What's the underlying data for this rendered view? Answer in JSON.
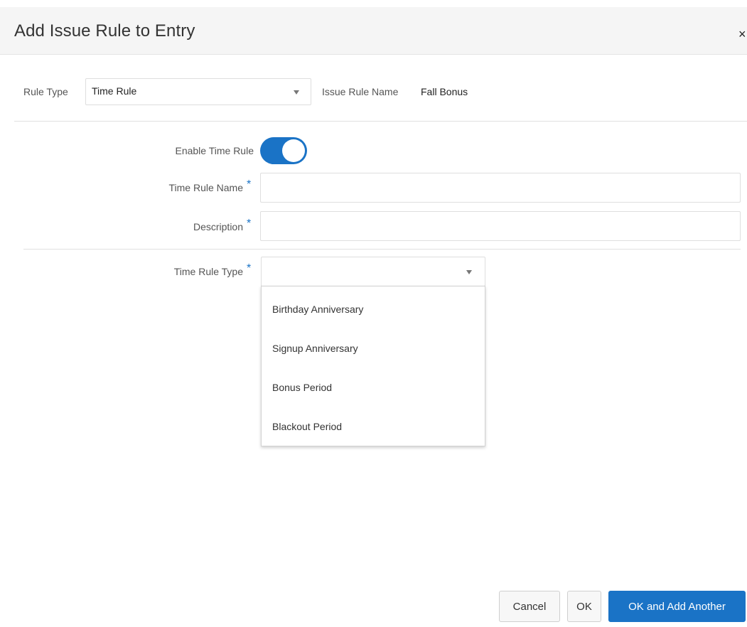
{
  "dialog": {
    "title": "Add Issue Rule to Entry",
    "close_glyph": "×"
  },
  "rule_row": {
    "rule_type_label": "Rule Type",
    "rule_type_value": "Time Rule",
    "issue_rule_name_label": "Issue Rule Name",
    "issue_rule_name_value": "Fall Bonus"
  },
  "form": {
    "enable_time_rule_label": "Enable Time Rule",
    "enable_time_rule_on": true,
    "time_rule_name_label": "Time Rule Name",
    "time_rule_name_value": "",
    "description_label": "Description",
    "description_value": "",
    "time_rule_type_label": "Time Rule Type",
    "time_rule_type_value": "",
    "required_mark": "*"
  },
  "time_rule_type_options": [
    "Birthday Anniversary",
    "Signup Anniversary",
    "Bonus Period",
    "Blackout Period"
  ],
  "footer": {
    "cancel_label": "Cancel",
    "ok_label": "OK",
    "ok_add_another_label": "OK and Add Another"
  },
  "colors": {
    "accent": "#1a73c6",
    "header_bg": "#f5f5f5"
  },
  "icons": {
    "close": "close-icon",
    "dropdown_arrow": "caret-down-icon"
  }
}
